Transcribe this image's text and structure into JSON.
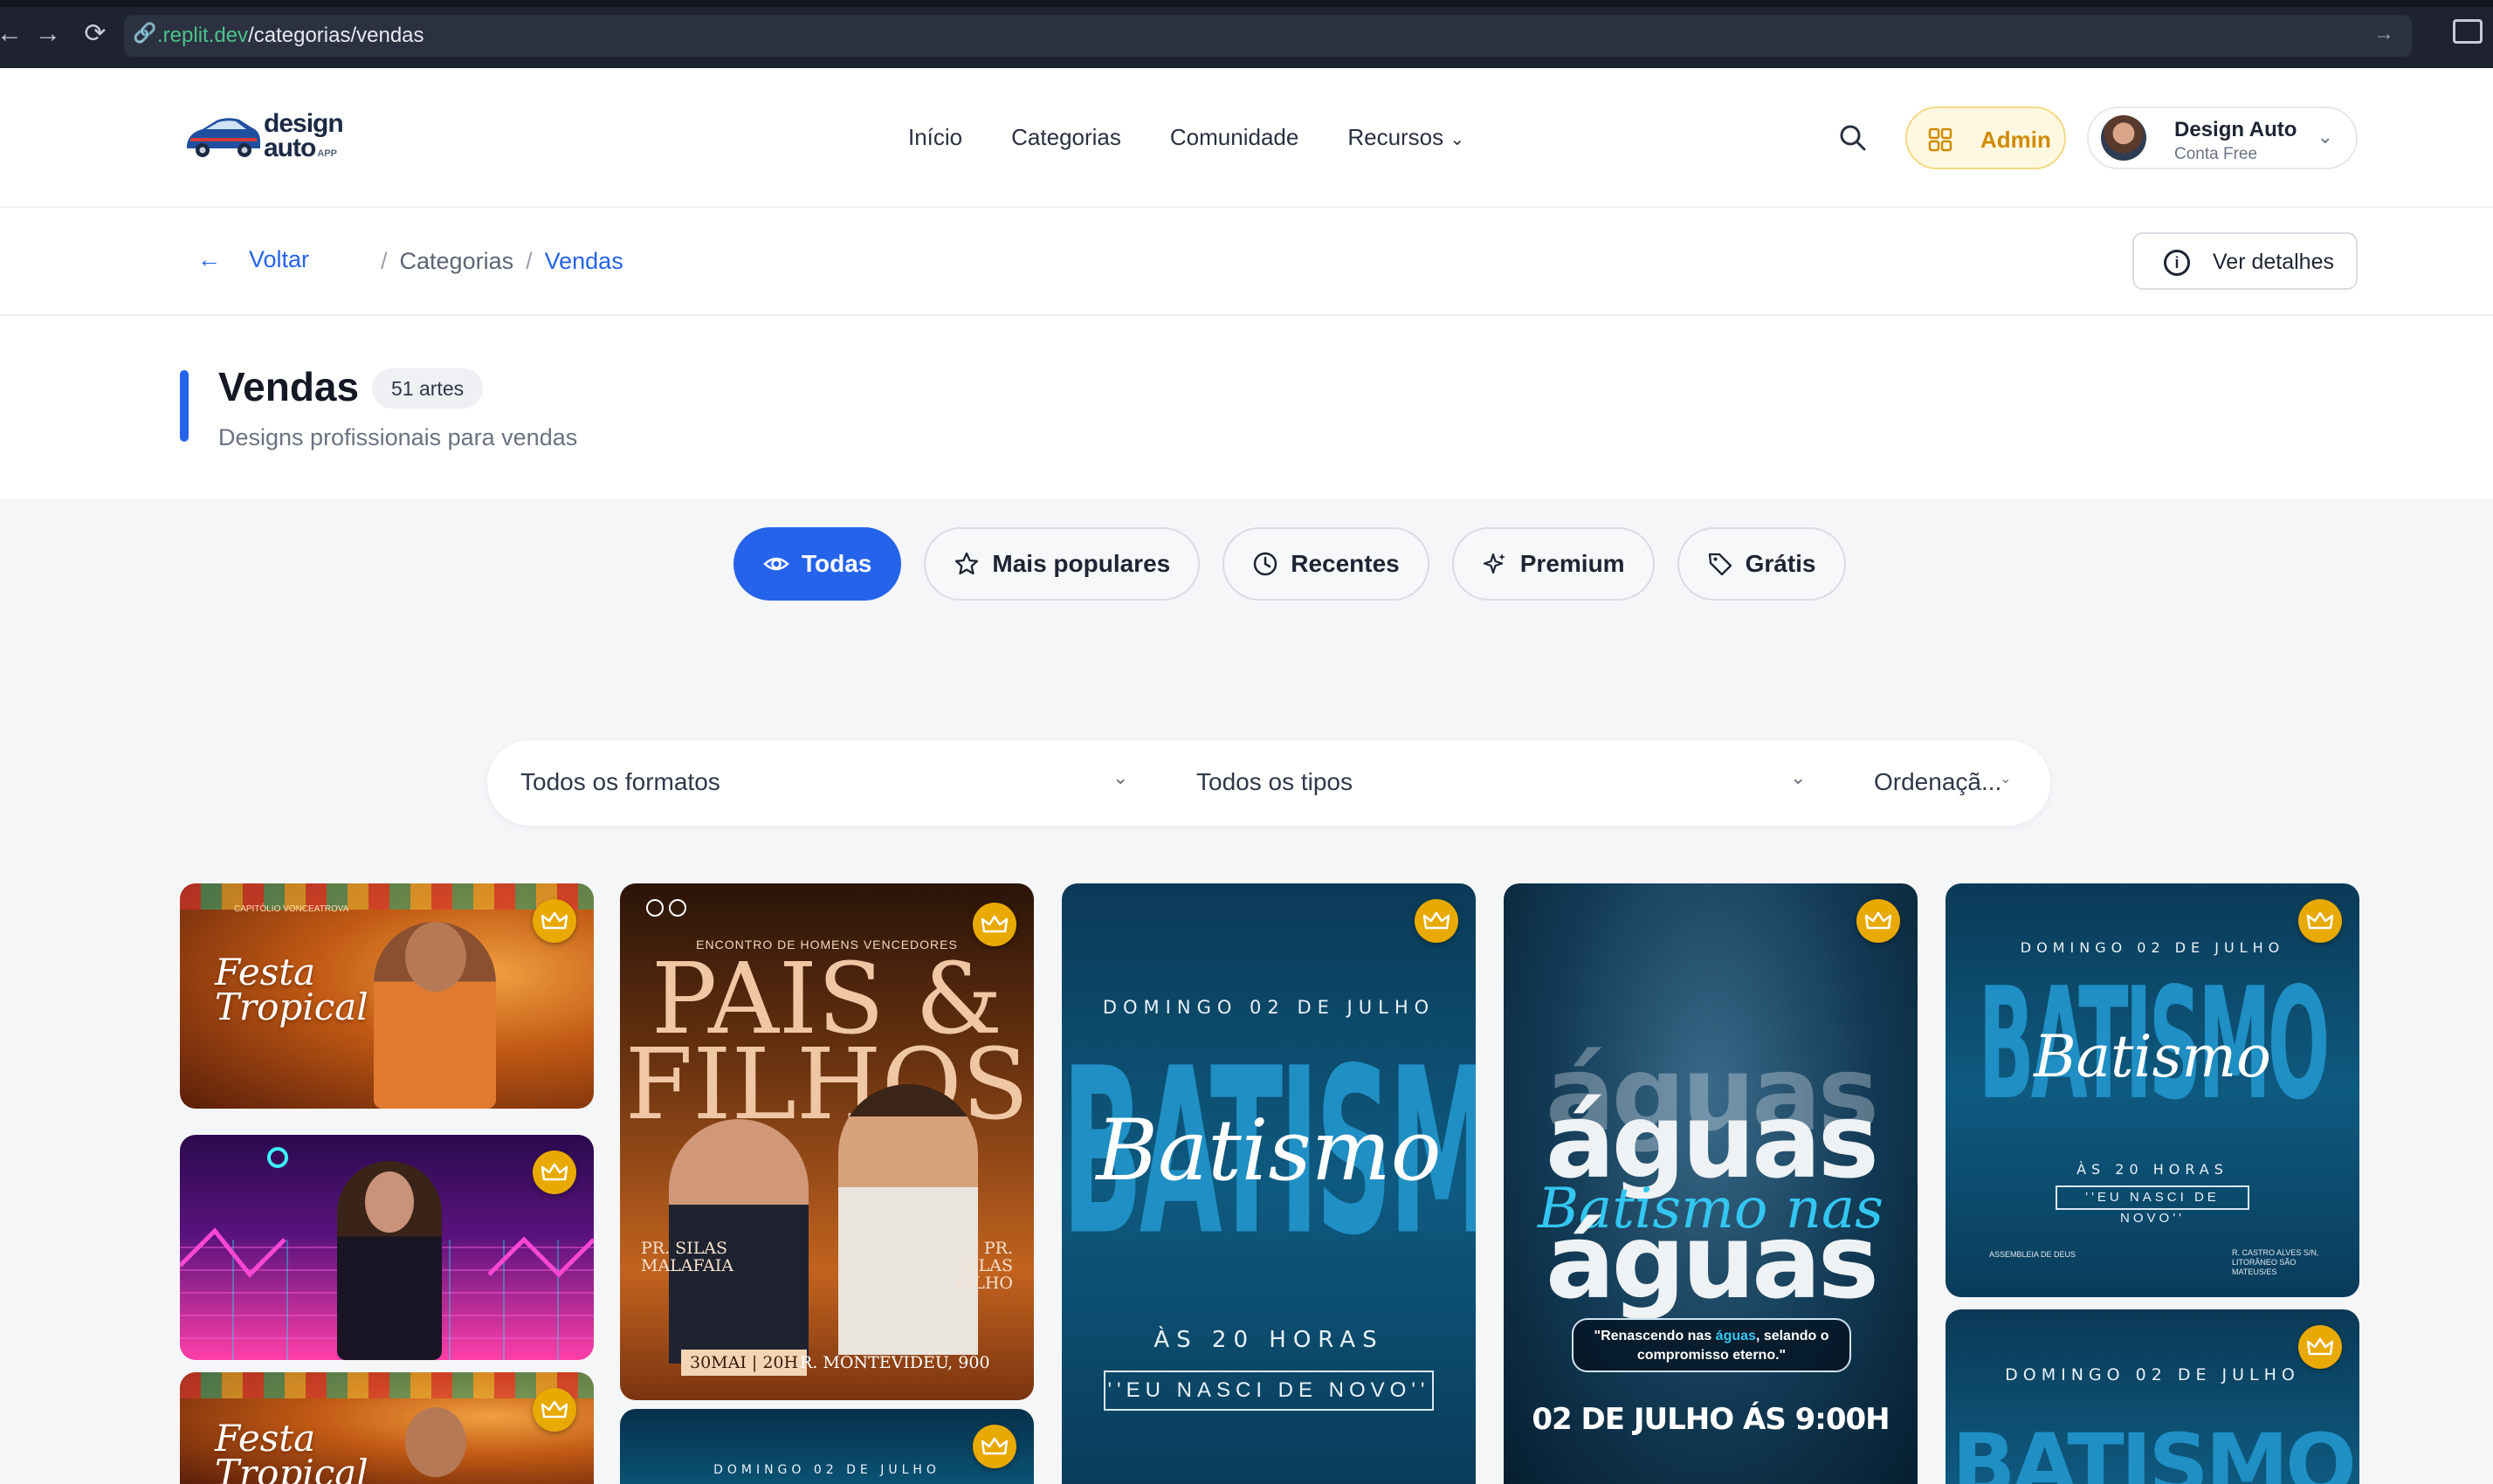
{
  "browser": {
    "url_host": ".replit.dev",
    "url_path": "/categorias/vendas"
  },
  "header": {
    "logo_word_1": "design",
    "logo_word_2": "auto",
    "logo_word_3": "APP",
    "nav": [
      "Início",
      "Categorias",
      "Comunidade",
      "Recursos"
    ],
    "admin_label": "Admin",
    "user_name": "Design Auto",
    "user_plan": "Conta Free"
  },
  "breadcrumb": {
    "back_label": "Voltar",
    "parent": "Categorias",
    "current": "Vendas",
    "details_label": "Ver detalhes"
  },
  "page": {
    "title": "Vendas",
    "count_badge": "51 artes",
    "subtitle": "Designs profissionais para vendas"
  },
  "filters": {
    "pills": [
      "Todas",
      "Mais populares",
      "Recentes",
      "Premium",
      "Grátis"
    ],
    "active": "Todas",
    "format_select": "Todos os formatos",
    "type_select": "Todos os tipos",
    "order_select": "Ordenaçã..."
  },
  "cards": {
    "festa": {
      "kicker": "CAPITÓLIO VONCEATROVA",
      "line1": "Festa",
      "line2": "Tropical"
    },
    "pais": {
      "kicker": "ENCONTRO DE HOMENS VENCEDORES",
      "line1": "PAIS &",
      "line2": "FILHOS",
      "speaker_left": "PR. SILAS MALAFAIA",
      "speaker_right": "PR. SILAS FILHO",
      "date": "30MAI | 20H",
      "address": "R. MONTEVIDÉU, 900"
    },
    "batismo": {
      "date": "DOMINGO 02 DE JULHO",
      "big": "BATISMO",
      "script": "Batismo",
      "time": "ÀS 20 HORAS",
      "quote": "''EU NASCI DE NOVO''"
    },
    "aguas": {
      "big": "águas",
      "script": "Batismo nas",
      "quote": "\"Renascendo nas águas, selando o compromisso eterno.\"",
      "quote_highlight": "águas",
      "date": "02 DE JULHO ÁS 9:00H"
    },
    "batismo_small": {
      "date": "DOMINGO 02 DE JULHO",
      "big": "BATISMO",
      "script": "Batismo",
      "time": "ÀS 20 HORAS",
      "quote": "''EU NASCI DE NOVO''",
      "church": "ASSEMBLEIA DE DEUS",
      "address": "R. CASTRO ALVES S/N, LITORÂNEO SÃO MATEUS/ES"
    }
  },
  "colors": {
    "accent": "#2563eb",
    "crown": "#e8a900",
    "admin_bg": "#fff8e1",
    "admin_text": "#d08a00"
  }
}
